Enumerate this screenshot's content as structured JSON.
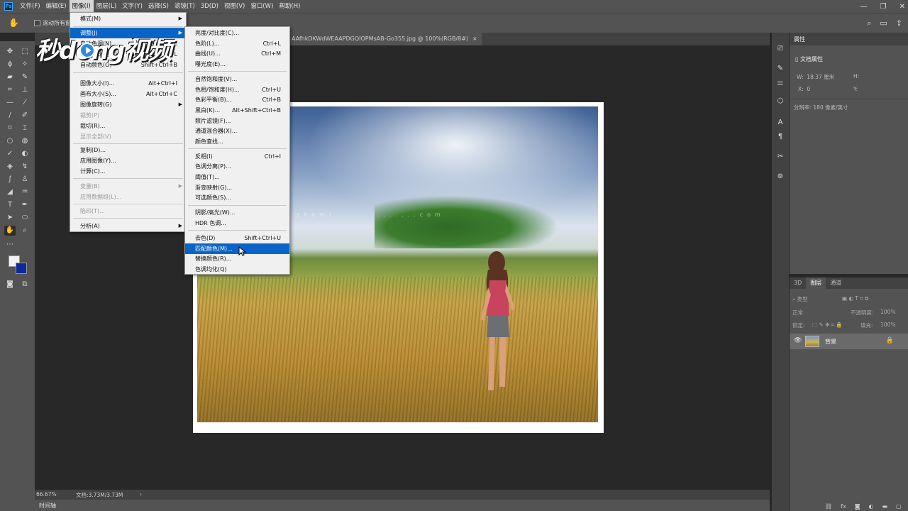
{
  "menubar": {
    "logo": "Ps",
    "items": [
      "文件(F)",
      "编辑(E)",
      "图像(I)",
      "图层(L)",
      "文字(Y)",
      "选择(S)",
      "滤镜(T)",
      "3D(D)",
      "视图(V)",
      "窗口(W)",
      "帮助(H)"
    ],
    "active_index": 2
  },
  "window_controls": {
    "minimize": "—",
    "restore": "❐",
    "close": "✕"
  },
  "options_bar": {
    "checkbox_label": "滚动所有窗口"
  },
  "document_tab": {
    "title": "AAfhkDKWdWEAAPDGQIOPMsAB-Go355.jpg @ 100%(RGB/8#)",
    "close": "×"
  },
  "image_menu": {
    "items": [
      {
        "label": "模式(M)",
        "shortcut": "",
        "submenu": true,
        "disabled": false
      },
      {
        "label": "调整(J)",
        "shortcut": "",
        "submenu": true,
        "disabled": false,
        "highlighted": true
      },
      {
        "label": "自动色调(N)",
        "shortcut": "Shift+Ctrl+L",
        "submenu": false,
        "disabled": false
      },
      {
        "label": "自动对比度(U)",
        "shortcut": "Alt+Shift+Ctrl+L",
        "submenu": false,
        "disabled": false
      },
      {
        "label": "自动颜色(O)",
        "shortcut": "Shift+Ctrl+B",
        "submenu": false,
        "disabled": false
      },
      {
        "label": "图像大小(I)...",
        "shortcut": "Alt+Ctrl+I",
        "submenu": false,
        "disabled": false
      },
      {
        "label": "画布大小(S)...",
        "shortcut": "Alt+Ctrl+C",
        "submenu": false,
        "disabled": false
      },
      {
        "label": "图像旋转(G)",
        "shortcut": "",
        "submenu": true,
        "disabled": false
      },
      {
        "label": "裁剪(P)",
        "shortcut": "",
        "submenu": false,
        "disabled": true
      },
      {
        "label": "裁切(R)...",
        "shortcut": "",
        "submenu": false,
        "disabled": false
      },
      {
        "label": "显示全部(V)",
        "shortcut": "",
        "submenu": false,
        "disabled": true
      },
      {
        "label": "复制(D)...",
        "shortcut": "",
        "submenu": false,
        "disabled": false
      },
      {
        "label": "应用图像(Y)...",
        "shortcut": "",
        "submenu": false,
        "disabled": false
      },
      {
        "label": "计算(C)...",
        "shortcut": "",
        "submenu": false,
        "disabled": false
      },
      {
        "label": "变量(B)",
        "shortcut": "",
        "submenu": true,
        "disabled": true
      },
      {
        "label": "应用数据组(L)...",
        "shortcut": "",
        "submenu": false,
        "disabled": true
      },
      {
        "label": "陷印(T)...",
        "shortcut": "",
        "submenu": false,
        "disabled": true
      },
      {
        "label": "分析(A)",
        "shortcut": "",
        "submenu": true,
        "disabled": false
      }
    ]
  },
  "adjust_menu": {
    "items": [
      {
        "label": "亮度/对比度(C)...",
        "shortcut": ""
      },
      {
        "label": "色阶(L)...",
        "shortcut": "Ctrl+L"
      },
      {
        "label": "曲线(U)...",
        "shortcut": "Ctrl+M"
      },
      {
        "label": "曝光度(E)...",
        "shortcut": ""
      },
      {
        "label": "自然饱和度(V)...",
        "shortcut": ""
      },
      {
        "label": "色相/饱和度(H)...",
        "shortcut": "Ctrl+U"
      },
      {
        "label": "色彩平衡(B)...",
        "shortcut": "Ctrl+B"
      },
      {
        "label": "黑白(K)...",
        "shortcut": "Alt+Shift+Ctrl+B"
      },
      {
        "label": "照片滤镜(F)...",
        "shortcut": ""
      },
      {
        "label": "通道混合器(X)...",
        "shortcut": ""
      },
      {
        "label": "颜色查找...",
        "shortcut": ""
      },
      {
        "label": "反相(I)",
        "shortcut": "Ctrl+I"
      },
      {
        "label": "色调分离(P)...",
        "shortcut": ""
      },
      {
        "label": "阈值(T)...",
        "shortcut": ""
      },
      {
        "label": "渐变映射(G)...",
        "shortcut": ""
      },
      {
        "label": "可选颜色(S)...",
        "shortcut": ""
      },
      {
        "label": "阴影/高光(W)...",
        "shortcut": ""
      },
      {
        "label": "HDR 色调...",
        "shortcut": ""
      },
      {
        "label": "去色(D)",
        "shortcut": "Shift+Ctrl+U"
      },
      {
        "label": "匹配颜色(M)...",
        "shortcut": "",
        "highlighted": true
      },
      {
        "label": "替换颜色(R)...",
        "shortcut": ""
      },
      {
        "label": "色调均化(Q)",
        "shortcut": ""
      }
    ]
  },
  "watermark_logo": {
    "text": "秒dong视频"
  },
  "photo": {
    "watermark_text": "shomi..............com"
  },
  "status_bar": {
    "zoom": "66.67%",
    "doc_size": "文档:3.73M/3.73M",
    "arrow": "›"
  },
  "timeline": {
    "label": "时间轴"
  },
  "properties_panel": {
    "tab": "属性",
    "section": "文档属性",
    "w_label": "W:",
    "w_value": "18.37 厘米",
    "h_label": "H:",
    "x_label": "X:",
    "x_value": "0",
    "y_label": "Y:",
    "resolution": "分辨率: 180 像素/英寸"
  },
  "layers_panel": {
    "tabs": [
      "3D",
      "图层",
      "通道"
    ],
    "active_tab": 1,
    "kind_placeholder": "类型",
    "blend_mode": "正常",
    "opacity_label": "不透明度:",
    "opacity_value": "100%",
    "lock_label": "锁定:",
    "fill_label": "填充:",
    "fill_value": "100%",
    "layer_name": "背景"
  },
  "colors": {
    "foreground": "#f2f2f2",
    "background": "#0c2a9c",
    "menu_highlight": "#0a64c8",
    "ui_panel": "#535353",
    "ui_dark": "#282828"
  }
}
